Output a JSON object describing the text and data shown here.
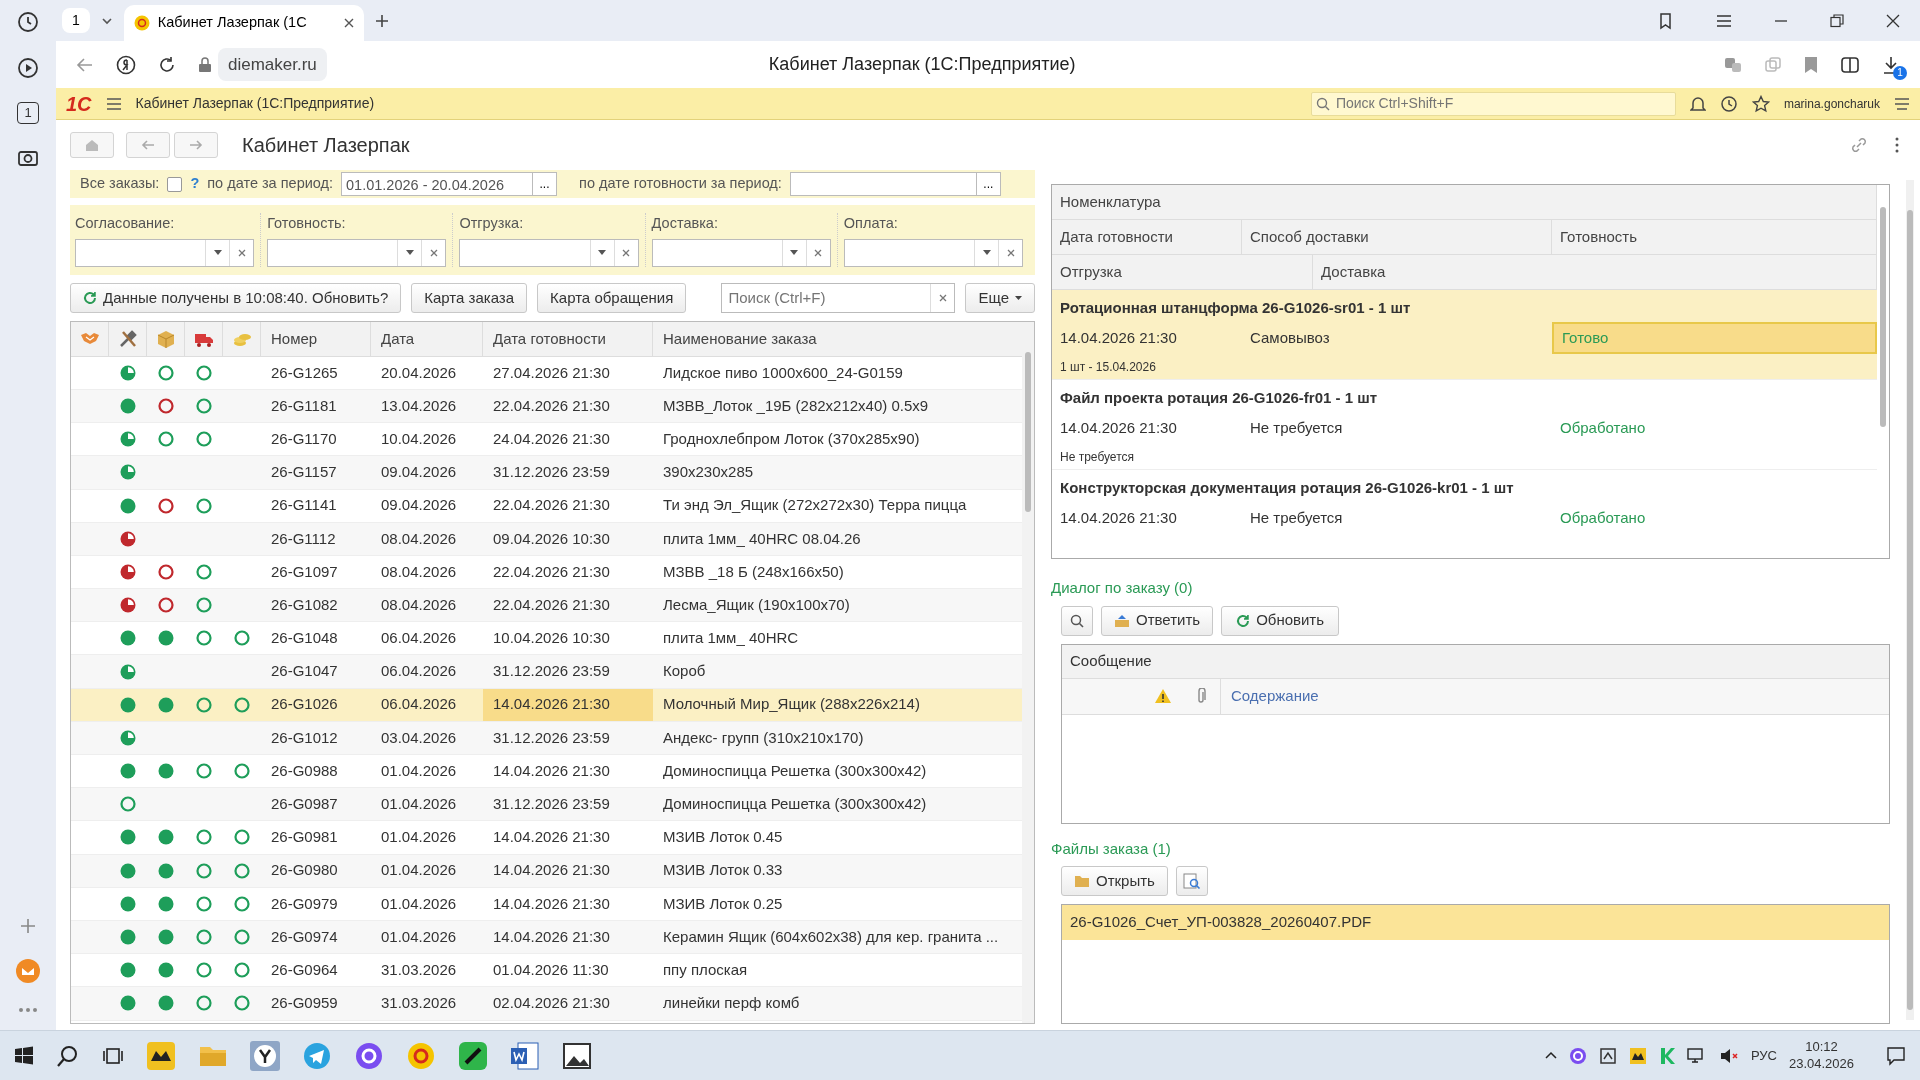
{
  "browser": {
    "sidebar_number": "1",
    "tab_count": "1",
    "tab_title": "Кабинет Лазерпак (1С",
    "url": "diemaker.ru",
    "page_title": "Кабинет Лазерпак (1С:Предприятие)",
    "download_badge": "1"
  },
  "app": {
    "logo": "1С",
    "title": "Кабинет Лазерпак  (1С:Предприятие)",
    "search_placeholder": "Поиск Ctrl+Shift+F",
    "user": "marina.goncharuk"
  },
  "form_title": "Кабинет Лазерпак",
  "filters": {
    "all_orders_label": "Все заказы:",
    "all_orders_checked": false,
    "help": "?",
    "period_label": "по дате за период:",
    "period_value": "01.01.2026 - 20.04.2026",
    "period_pick": "...",
    "ready_period_label": "по дате готовности за период:",
    "ready_period_pick": "...",
    "selects": [
      {
        "label": "Согласование:"
      },
      {
        "label": "Готовность:"
      },
      {
        "label": "Отгрузка:"
      },
      {
        "label": "Доставка:"
      },
      {
        "label": "Оплата:"
      }
    ]
  },
  "toolbar": {
    "refresh": "Данные получены в 10:08:40. Обновить?",
    "buttons": [
      "Карта заказа",
      "Карта обращения"
    ],
    "search_placeholder": "Поиск (Ctrl+F)",
    "more": "Еще"
  },
  "orders": {
    "columns": [
      "Номер",
      "Дата",
      "Дата готовности",
      "Наименование заказа"
    ],
    "rows": [
      {
        "statuses": [
          {
            "kind": "half",
            "color": "#1e9e5a"
          },
          {
            "kind": "ring",
            "color": "#1e9e5a"
          },
          {
            "kind": "ring",
            "color": "#1e9e5a"
          }
        ],
        "number": "26-G1265",
        "date": "20.04.2026",
        "ready": "27.04.2026 21:30",
        "name": "Лидское пиво 1000x600_24-G0159",
        "selected": false
      },
      {
        "statuses": [
          {
            "kind": "full",
            "color": "#1e9e5a"
          },
          {
            "kind": "ring",
            "color": "#c0282d"
          },
          {
            "kind": "ring",
            "color": "#1e9e5a"
          }
        ],
        "number": "26-G1181",
        "date": "13.04.2026",
        "ready": "22.04.2026 21:30",
        "name": "МЗВВ_Лоток _19Б (282x212x40) 0.5x9",
        "selected": false
      },
      {
        "statuses": [
          {
            "kind": "half",
            "color": "#1e9e5a"
          },
          {
            "kind": "ring",
            "color": "#1e9e5a"
          },
          {
            "kind": "ring",
            "color": "#1e9e5a"
          }
        ],
        "number": "26-G1170",
        "date": "10.04.2026",
        "ready": "24.04.2026 21:30",
        "name": "Гроднохлебпром Лоток (370x285x90)",
        "selected": false
      },
      {
        "statuses": [
          {
            "kind": "half",
            "color": "#1e9e5a"
          }
        ],
        "number": "26-G1157",
        "date": "09.04.2026",
        "ready": "31.12.2026 23:59",
        "name": "390x230x285",
        "selected": false
      },
      {
        "statuses": [
          {
            "kind": "full",
            "color": "#1e9e5a"
          },
          {
            "kind": "ring",
            "color": "#c0282d"
          },
          {
            "kind": "ring",
            "color": "#1e9e5a"
          }
        ],
        "number": "26-G1141",
        "date": "09.04.2026",
        "ready": "22.04.2026 21:30",
        "name": "Ти энд Эл_Ящик (272x272x30) Терра пицца",
        "selected": false
      },
      {
        "statuses": [
          {
            "kind": "half",
            "color": "#c0282d"
          }
        ],
        "number": "26-G1112",
        "date": "08.04.2026",
        "ready": "09.04.2026 10:30",
        "name": "плита 1мм_ 40HRC 08.04.26",
        "selected": false
      },
      {
        "statuses": [
          {
            "kind": "half",
            "color": "#c0282d"
          },
          {
            "kind": "ring",
            "color": "#c0282d"
          },
          {
            "kind": "ring",
            "color": "#1e9e5a"
          }
        ],
        "number": "26-G1097",
        "date": "08.04.2026",
        "ready": "22.04.2026 21:30",
        "name": "МЗВВ _18 Б (248x166x50)",
        "selected": false
      },
      {
        "statuses": [
          {
            "kind": "half",
            "color": "#c0282d"
          },
          {
            "kind": "ring",
            "color": "#c0282d"
          },
          {
            "kind": "ring",
            "color": "#1e9e5a"
          }
        ],
        "number": "26-G1082",
        "date": "08.04.2026",
        "ready": "22.04.2026 21:30",
        "name": "Лесма_Ящик (190x100x70)",
        "selected": false
      },
      {
        "statuses": [
          {
            "kind": "full",
            "color": "#1e9e5a"
          },
          {
            "kind": "full",
            "color": "#1e9e5a"
          },
          {
            "kind": "ring",
            "color": "#1e9e5a"
          },
          {
            "kind": "ring",
            "color": "#1e9e5a"
          }
        ],
        "number": "26-G1048",
        "date": "06.04.2026",
        "ready": "10.04.2026 10:30",
        "name": "плита 1мм_ 40HRC",
        "selected": false
      },
      {
        "statuses": [
          {
            "kind": "half",
            "color": "#1e9e5a"
          }
        ],
        "number": "26-G1047",
        "date": "06.04.2026",
        "ready": "31.12.2026 23:59",
        "name": "Короб",
        "selected": false
      },
      {
        "statuses": [
          {
            "kind": "full",
            "color": "#1e9e5a"
          },
          {
            "kind": "full",
            "color": "#1e9e5a"
          },
          {
            "kind": "ring",
            "color": "#1e9e5a"
          },
          {
            "kind": "ring",
            "color": "#1e9e5a"
          }
        ],
        "number": "26-G1026",
        "date": "06.04.2026",
        "ready": "14.04.2026 21:30",
        "name": "Молочный Мир_Ящик (288x226x214)",
        "selected": true
      },
      {
        "statuses": [
          {
            "kind": "half",
            "color": "#1e9e5a"
          }
        ],
        "number": "26-G1012",
        "date": "03.04.2026",
        "ready": "31.12.2026 23:59",
        "name": "Андекс- групп (310x210x170)",
        "selected": false
      },
      {
        "statuses": [
          {
            "kind": "full",
            "color": "#1e9e5a"
          },
          {
            "kind": "full",
            "color": "#1e9e5a"
          },
          {
            "kind": "ring",
            "color": "#1e9e5a"
          },
          {
            "kind": "ring",
            "color": "#1e9e5a"
          }
        ],
        "number": "26-G0988",
        "date": "01.04.2026",
        "ready": "14.04.2026 21:30",
        "name": "Доминоспицца Решетка (300x300x42)",
        "selected": false
      },
      {
        "statuses": [
          {
            "kind": "ring",
            "color": "#1e9e5a"
          }
        ],
        "number": "26-G0987",
        "date": "01.04.2026",
        "ready": "31.12.2026 23:59",
        "name": "Доминоспицца Решетка (300x300x42)",
        "selected": false
      },
      {
        "statuses": [
          {
            "kind": "full",
            "color": "#1e9e5a"
          },
          {
            "kind": "full",
            "color": "#1e9e5a"
          },
          {
            "kind": "ring",
            "color": "#1e9e5a"
          },
          {
            "kind": "ring",
            "color": "#1e9e5a"
          }
        ],
        "number": "26-G0981",
        "date": "01.04.2026",
        "ready": "14.04.2026 21:30",
        "name": "МЗИВ Лоток 0.45",
        "selected": false
      },
      {
        "statuses": [
          {
            "kind": "full",
            "color": "#1e9e5a"
          },
          {
            "kind": "full",
            "color": "#1e9e5a"
          },
          {
            "kind": "ring",
            "color": "#1e9e5a"
          },
          {
            "kind": "ring",
            "color": "#1e9e5a"
          }
        ],
        "number": "26-G0980",
        "date": "01.04.2026",
        "ready": "14.04.2026 21:30",
        "name": "МЗИВ Лоток 0.33",
        "selected": false
      },
      {
        "statuses": [
          {
            "kind": "full",
            "color": "#1e9e5a"
          },
          {
            "kind": "full",
            "color": "#1e9e5a"
          },
          {
            "kind": "ring",
            "color": "#1e9e5a"
          },
          {
            "kind": "ring",
            "color": "#1e9e5a"
          }
        ],
        "number": "26-G0979",
        "date": "01.04.2026",
        "ready": "14.04.2026 21:30",
        "name": "МЗИВ Лоток 0.25",
        "selected": false
      },
      {
        "statuses": [
          {
            "kind": "full",
            "color": "#1e9e5a"
          },
          {
            "kind": "full",
            "color": "#1e9e5a"
          },
          {
            "kind": "ring",
            "color": "#1e9e5a"
          },
          {
            "kind": "ring",
            "color": "#1e9e5a"
          }
        ],
        "number": "26-G0974",
        "date": "01.04.2026",
        "ready": "14.04.2026 21:30",
        "name": "Керамин Ящик (604x602x38) для кер. гранита ...",
        "selected": false
      },
      {
        "statuses": [
          {
            "kind": "full",
            "color": "#1e9e5a"
          },
          {
            "kind": "full",
            "color": "#1e9e5a"
          },
          {
            "kind": "ring",
            "color": "#1e9e5a"
          },
          {
            "kind": "ring",
            "color": "#1e9e5a"
          }
        ],
        "number": "26-G0964",
        "date": "31.03.2026",
        "ready": "01.04.2026 11:30",
        "name": "ппу плоская",
        "selected": false
      },
      {
        "statuses": [
          {
            "kind": "full",
            "color": "#1e9e5a"
          },
          {
            "kind": "full",
            "color": "#1e9e5a"
          },
          {
            "kind": "ring",
            "color": "#1e9e5a"
          },
          {
            "kind": "ring",
            "color": "#1e9e5a"
          }
        ],
        "number": "26-G0959",
        "date": "31.03.2026",
        "ready": "02.04.2026 21:30",
        "name": "линейки перф комб",
        "selected": false
      }
    ]
  },
  "nomenclature": {
    "header": "Номенклатура",
    "header_row2": [
      "Дата готовности",
      "Способ доставки",
      "Готовность"
    ],
    "header_row3": [
      "Отгрузка",
      "Доставка"
    ],
    "items": [
      {
        "title": "Ротационная штанцформа 26-G1026-sr01 - 1 шт",
        "date": "14.04.2026 21:30",
        "delivery": "Самовывоз",
        "status": "Готово",
        "shipment": "1 шт - 15.04.2026",
        "selected": true
      },
      {
        "title": "Файл проекта ротация 26-G1026-fr01 - 1 шт",
        "date": "14.04.2026 21:30",
        "delivery": "Не требуется",
        "status": "Обработано",
        "shipment": "Не требуется",
        "selected": false
      },
      {
        "title": "Конструкторская документация ротация 26-G1026-kr01 - 1 шт",
        "date": "14.04.2026 21:30",
        "delivery": "Не требуется",
        "status": "Обработано",
        "selected": false
      }
    ]
  },
  "dialog": {
    "title": "Диалог по заказу (0)",
    "reply": "Ответить",
    "refresh": "Обновить",
    "header": "Сообщение",
    "content_column": "Содержание"
  },
  "files": {
    "title": "Файлы заказа (1)",
    "open": "Открыть",
    "items": [
      {
        "name": "26-G1026_Счет_УП-003828_20260407.PDF",
        "selected": true
      }
    ]
  },
  "taskbar": {
    "language": "РУС",
    "time": "10:12",
    "date": "23.04.2026"
  }
}
